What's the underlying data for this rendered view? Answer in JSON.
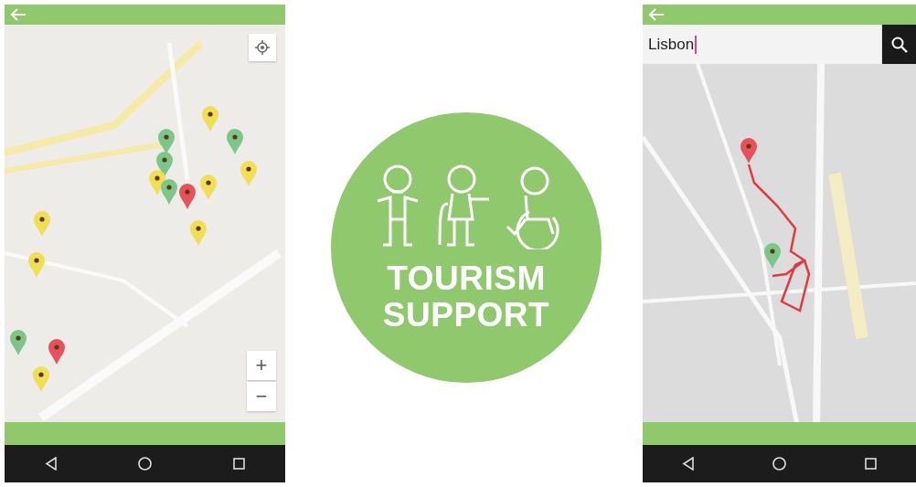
{
  "screens": [
    {
      "kind": "pins",
      "pins": [
        {
          "color": "#f0de55"
        },
        {
          "color": "#7cc68a"
        },
        {
          "color": "#7cc68a"
        },
        {
          "color": "#7cc68a"
        },
        {
          "color": "#e8505b"
        },
        {
          "color": "#f0de55"
        },
        {
          "color": "#7cc68a"
        },
        {
          "color": "#f0de55"
        },
        {
          "color": "#f0de55"
        },
        {
          "color": "#f0de55"
        },
        {
          "color": "#f0de55"
        },
        {
          "color": "#f0de55"
        },
        {
          "color": "#f0de55"
        },
        {
          "color": "#7cc68a"
        },
        {
          "color": "#e8505b"
        }
      ],
      "zoom_in": "+",
      "zoom_out": "−"
    },
    {
      "kind": "route",
      "search": {
        "value": "Lisbon"
      },
      "pins": [
        {
          "color": "#e8505b"
        },
        {
          "color": "#7cc68a"
        }
      ]
    }
  ],
  "logo": {
    "title": "TOURISM",
    "subtitle": "SUPPORT"
  }
}
